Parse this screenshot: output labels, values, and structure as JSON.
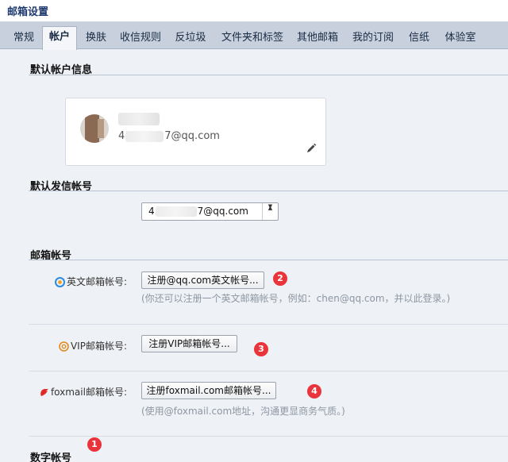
{
  "header": {
    "title": "邮箱设置"
  },
  "tabs": [
    {
      "label": "常规"
    },
    {
      "label": "帐户"
    },
    {
      "label": "换肤"
    },
    {
      "label": "收信规则"
    },
    {
      "label": "反垃圾"
    },
    {
      "label": "文件夹和标签"
    },
    {
      "label": "其他邮箱"
    },
    {
      "label": "我的订阅"
    },
    {
      "label": "信纸"
    },
    {
      "label": "体验室"
    }
  ],
  "active_tab": "帐户",
  "default_account": {
    "section_title": "默认帐户信息",
    "email_prefix": "4",
    "email_suffix": "7@qq.com"
  },
  "default_sender": {
    "section_title": "默认发信帐号",
    "select_prefix": "4",
    "select_suffix": "7@qq.com"
  },
  "mailbox_accounts": {
    "section_title": "邮箱帐号",
    "english": {
      "label": "英文邮箱帐号:",
      "button": "注册@qq.com英文帐号...",
      "hint": "(你还可以注册一个英文邮箱帐号，例如：chen@qq.com，并以此登录。)"
    },
    "vip": {
      "label": "VIP邮箱帐号:",
      "button": "注册VIP邮箱帐号..."
    },
    "foxmail": {
      "label": "foxmail邮箱帐号:",
      "button": "注册foxmail.com邮箱帐号...",
      "hint": "(使用@foxmail.com地址，沟通更显商务气质。)"
    }
  },
  "digital_account": {
    "section_title": "数字帐号"
  },
  "markers": [
    "1",
    "2",
    "3",
    "4"
  ],
  "colors": {
    "accent": "#1e3a6e",
    "marker": "#e8343a",
    "tabbar": "#c7d0dc"
  }
}
